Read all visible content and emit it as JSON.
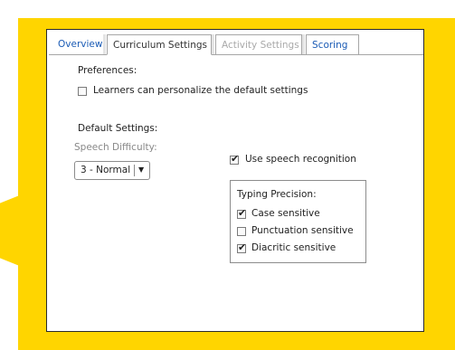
{
  "tabs": [
    {
      "label": "Overview",
      "state": "normal"
    },
    {
      "label": "Curriculum Settings",
      "state": "active"
    },
    {
      "label": "Activity Settings",
      "state": "disabled"
    },
    {
      "label": "Scoring",
      "state": "normal"
    }
  ],
  "preferences": {
    "heading": "Preferences:",
    "personalize": {
      "label": "Learners can personalize the default settings",
      "checked": false
    }
  },
  "default_settings": {
    "heading": "Default Settings:",
    "speech_difficulty": {
      "label": "Speech Difficulty:",
      "value": "3 - Normal"
    },
    "speech_recognition": {
      "label": "Use speech recognition",
      "checked": true
    },
    "typing_precision": {
      "heading": "Typing Precision:",
      "options": [
        {
          "label": "Case sensitive",
          "checked": true
        },
        {
          "label": "Punctuation sensitive",
          "checked": false
        },
        {
          "label": "Diacritic sensitive",
          "checked": true
        }
      ]
    }
  },
  "icons": {
    "check": "✔",
    "dropdown_arrow": "▼"
  },
  "colors": {
    "accent_yellow": "#ffd500",
    "link_blue": "#1a5bb5",
    "disabled_grey": "#a9a9a9"
  }
}
